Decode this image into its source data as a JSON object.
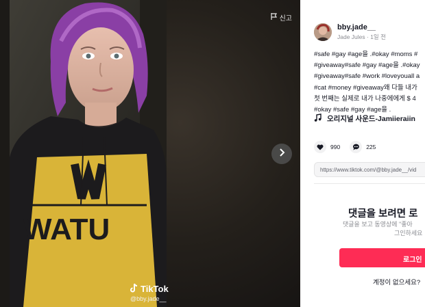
{
  "video": {
    "report_label": "신고",
    "watermark_brand": "TikTok",
    "watermark_user": "@bby.jade__"
  },
  "author": {
    "username": "bby.jade__",
    "subline": "Jade Jules · 1일 전"
  },
  "description": {
    "lines": [
      "#safe #gay #age을 .#okay #moms #",
      "#giveaway#safe #gay #age을 .#okay",
      "#giveaway#safe #work #loveyouall a",
      "#cat #money #giveaway왜 다들 내가",
      "첫 번째는 실제로 내가 나중에에게 $ 4",
      "#okay #safe #gay #age을 ."
    ]
  },
  "music": {
    "label": "오리지널 사운드-Jamiieraiin"
  },
  "actions": {
    "likes": "990",
    "comments": "225"
  },
  "share": {
    "url": "https://www.tiktok.com/@bby.jade__/vid"
  },
  "login": {
    "title": "댓글을 보려면 로",
    "sub_line1": "댓글을 보고 동영상에 \"좋아",
    "sub_line2": "그인하세요",
    "button": "로그인",
    "signup": "계정이 없으세요?"
  },
  "colors": {
    "accent": "#fe2c55",
    "panel_bg": "#ffffff",
    "text": "#161823"
  },
  "icons": [
    "flag-icon",
    "chevron-right-icon",
    "tiktok-logo-icon",
    "music-note-icon",
    "heart-icon",
    "comment-icon"
  ]
}
